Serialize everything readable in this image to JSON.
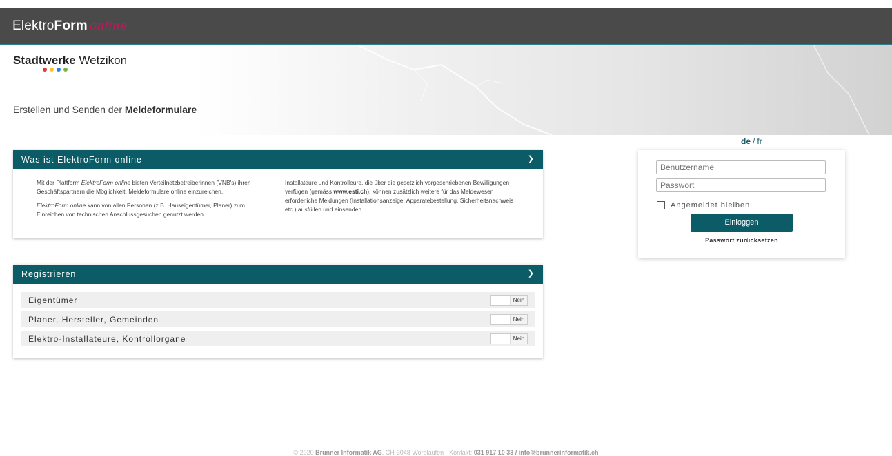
{
  "header": {
    "brand_part1": "Elektro",
    "brand_part2": "Form",
    "brand_part3": "online"
  },
  "hero": {
    "logo_bold": "Stadtwerke",
    "logo_regular": "Wetzikon",
    "logo_dot_colors": [
      "#e53935",
      "#fbc02d",
      "#1e88e5",
      "#7cb342"
    ],
    "tagline_prefix": "Erstellen und Senden der",
    "tagline_bold": "Meldeformulare"
  },
  "language": {
    "selected": "de",
    "separator": "/",
    "other": "fr"
  },
  "info_panel": {
    "title": "Was ist ElektroForm online",
    "chevron": "chevron-down-icon",
    "col1_p1_a": "Mit der Plattform ",
    "col1_p1_b": "ElektroForm online",
    "col1_p1_c": " bieten Verteilnetzbetreiberinnen (VNB's) ihren Geschäftspartnern die Möglichkeit, Meldeformulare online einzureichen.",
    "col1_p2_a": "ElektroForm online",
    "col1_p2_b": " kann von allen Personen (z.B. Hauseigentümer, Planer) zum Einreichen von technischen Anschlussgesuchen genutzt werden.",
    "col2_a": "Installateure und Kontrolleure, die über die gesetzlich vorgeschriebenen Bewilligungen verfügen (gemäss ",
    "col2_link": "www.esti.ch",
    "col2_b": "), können zusätzlich weitere für das Meldewesen erforderliche Meldungen (Installationsanzeige, Apparatebestellung, Sicherheitsnachweis etc.) ausfüllen und einsenden."
  },
  "register_panel": {
    "title": "Registrieren",
    "rows": [
      {
        "label": "Eigentümer",
        "toggle": "Nein"
      },
      {
        "label": "Planer, Hersteller, Gemeinden",
        "toggle": "Nein"
      },
      {
        "label": "Elektro-Installateure, Kontrollorgane",
        "toggle": "Nein"
      }
    ]
  },
  "login": {
    "username_placeholder": "Benutzername",
    "password_placeholder": "Passwort",
    "remember_label": "Angemeldet bleiben",
    "submit_label": "Einloggen",
    "reset_link": "Passwort zurücksetzen"
  },
  "footer": {
    "prefix": "© 2020 ",
    "company": "Brunner Informatik AG",
    "middle": ", CH-3048 Worblaufen - Kontakt: ",
    "contact": "031 917 10 33 / info@brunnerinformatik.ch"
  },
  "colors": {
    "accent": "#0b5c67",
    "topbar": "#4a4a4a",
    "brand_script": "#c2185b"
  }
}
